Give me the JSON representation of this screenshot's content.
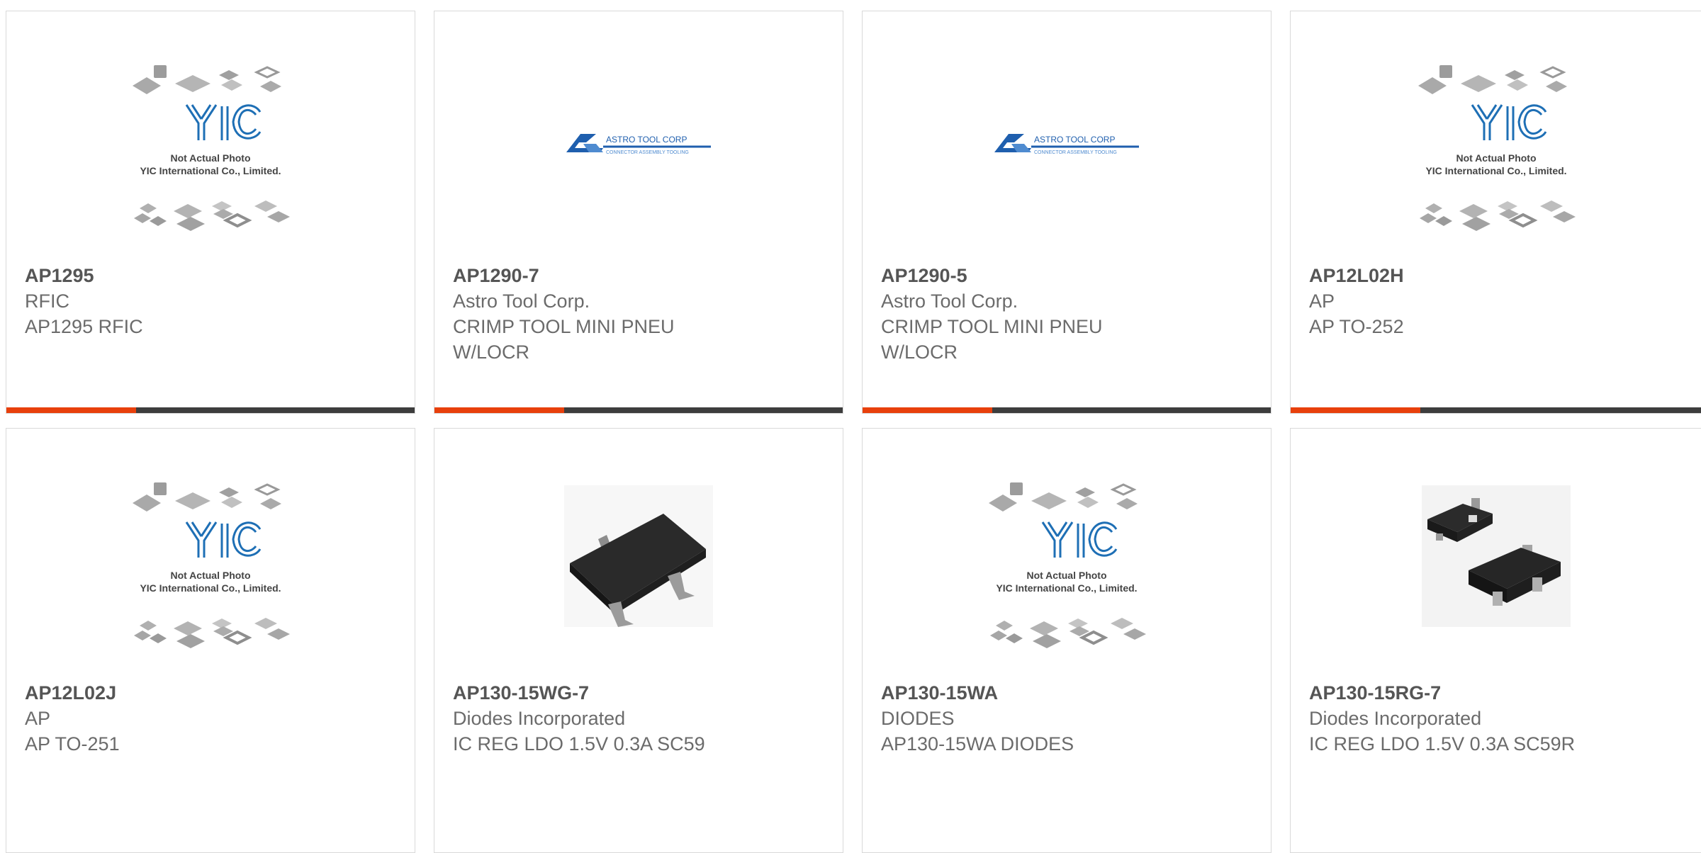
{
  "colors": {
    "accent": "#e8400c",
    "bar": "#3d3d3d",
    "card_border": "#d9d9d9",
    "yic_blue": "#1e6fb5",
    "astro_blue": "#1f5fae"
  },
  "products": [
    {
      "part": "AP1295",
      "manufacturer": "RFIC",
      "description": "AP1295 RFIC",
      "image": "yic-placeholder",
      "image_caption_1": "Not Actual Photo",
      "image_caption_2": "YIC International Co., Limited."
    },
    {
      "part": "AP1290-7",
      "manufacturer": "Astro Tool Corp.",
      "description": "CRIMP TOOL MINI PNEU W/LOCR",
      "image": "astro-tool-logo",
      "image_logo_text": "ASTRO TOOL CORP",
      "image_logo_sub": "CONNECTOR ASSEMBLY TOOLING"
    },
    {
      "part": "AP1290-5",
      "manufacturer": "Astro Tool Corp.",
      "description": "CRIMP TOOL MINI PNEU W/LOCR",
      "image": "astro-tool-logo",
      "image_logo_text": "ASTRO TOOL CORP",
      "image_logo_sub": "CONNECTOR ASSEMBLY TOOLING"
    },
    {
      "part": "AP12L02H",
      "manufacturer": "AP",
      "description": "AP TO-252",
      "image": "yic-placeholder",
      "image_caption_1": "Not Actual Photo",
      "image_caption_2": "YIC International Co., Limited."
    },
    {
      "part": "AP12L02J",
      "manufacturer": "AP",
      "description": "AP TO-251",
      "image": "yic-placeholder",
      "image_caption_1": "Not Actual Photo",
      "image_caption_2": "YIC International Co., Limited."
    },
    {
      "part": "AP130-15WG-7",
      "manufacturer": "Diodes Incorporated",
      "description": "IC REG LDO 1.5V 0.3A SC59",
      "image": "sot23-chip-photo"
    },
    {
      "part": "AP130-15WA",
      "manufacturer": "DIODES",
      "description": "AP130-15WA DIODES",
      "image": "yic-placeholder",
      "image_caption_1": "Not Actual Photo",
      "image_caption_2": "YIC International Co., Limited."
    },
    {
      "part": "AP130-15RG-7",
      "manufacturer": "Diodes Incorporated",
      "description": "IC REG LDO 1.5V 0.3A SC59R",
      "image": "sot23-pair-photo"
    }
  ]
}
